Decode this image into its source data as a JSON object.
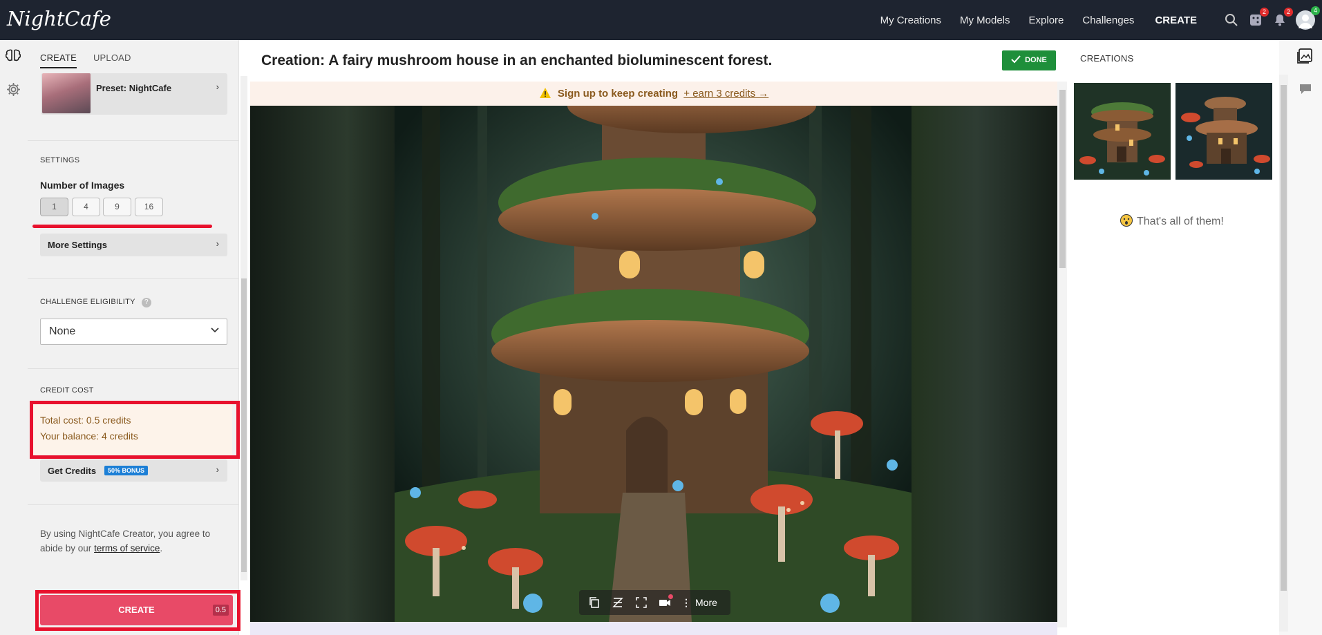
{
  "app": {
    "logo": "NightCafe"
  },
  "topnav": {
    "links": [
      "My Creations",
      "My Models",
      "Explore",
      "Challenges"
    ],
    "create": "CREATE",
    "badges": {
      "dice": "2",
      "bell": "2",
      "avatar": "4"
    }
  },
  "sidebar": {
    "tabs": [
      "CREATE",
      "UPLOAD"
    ],
    "preset_label": "Preset: NightCafe",
    "settings_header": "SETTINGS",
    "num_images_label": "Number of Images",
    "num_images_options": [
      "1",
      "4",
      "9",
      "16"
    ],
    "num_images_selected": "1",
    "more_settings": "More Settings",
    "challenge_header": "CHALLENGE ELIGIBILITY",
    "challenge_value": "None",
    "credit_header": "CREDIT COST",
    "total_cost": "Total cost: 0.5 credits",
    "balance": "Your balance: 4 credits",
    "get_credits": "Get Credits",
    "bonus_badge": "50% BONUS",
    "terms_text": "By using NightCafe Creator, you agree to abide by our",
    "terms_link": "terms of service",
    "terms_end": ".",
    "create_button": "CREATE",
    "create_cost": "0.5"
  },
  "main": {
    "title": "Creation: A fairy mushroom house in an enchanted bioluminescent forest.",
    "done_button": "DONE",
    "banner_text": "Sign up to keep creating",
    "banner_link": "+ earn 3 credits →",
    "toolbar_more": "More"
  },
  "right": {
    "header": "CREATIONS",
    "all_text": "That's all of them!"
  },
  "colors": {
    "topbar": "#1e2430",
    "accent_create": "#e84a67",
    "done_green": "#1e8f3a",
    "highlight_red": "#e8112d",
    "bonus_blue": "#1c7fd6"
  }
}
